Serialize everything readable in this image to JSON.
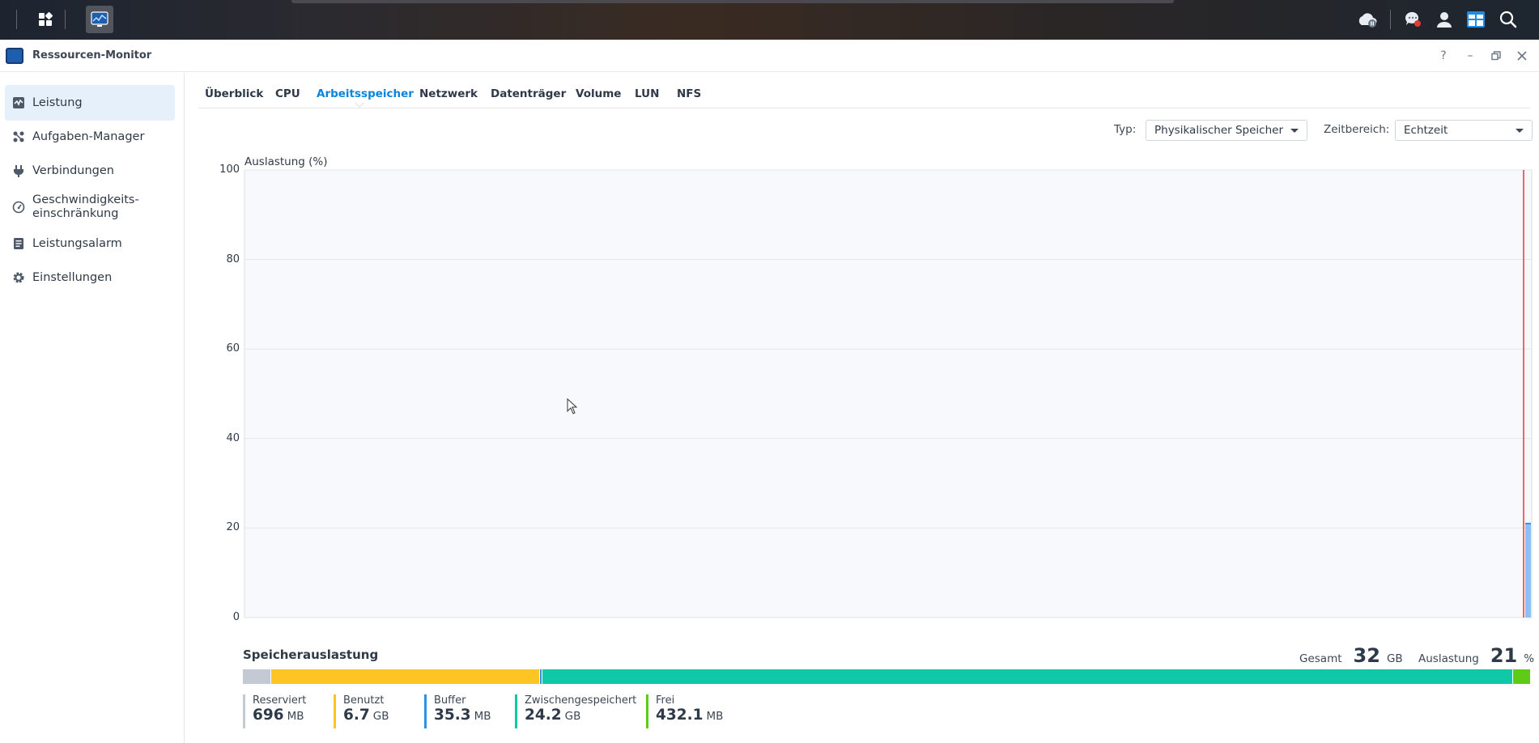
{
  "window": {
    "title": "Ressourcen-Monitor"
  },
  "sidebar": {
    "items": [
      {
        "label": "Leistung",
        "icon": "performance-icon",
        "active": true
      },
      {
        "label": "Aufgaben-Manager",
        "icon": "task-manager-icon"
      },
      {
        "label": "Verbindungen",
        "icon": "plug-icon"
      },
      {
        "label": "Geschwindigkeits-\neinschränkung",
        "icon": "speedometer-icon"
      },
      {
        "label": "Leistungsalarm",
        "icon": "alarm-list-icon"
      },
      {
        "label": "Einstellungen",
        "icon": "gear-icon"
      }
    ]
  },
  "tabs": [
    {
      "label": "Überblick"
    },
    {
      "label": "CPU"
    },
    {
      "label": "Arbeitsspeicher",
      "active": true
    },
    {
      "label": "Netzwerk"
    },
    {
      "label": "Datenträger"
    },
    {
      "label": "Volume"
    },
    {
      "label": "LUN"
    },
    {
      "label": "NFS"
    }
  ],
  "filters": {
    "type_label": "Typ:",
    "type_value": "Physikalischer Speicher",
    "range_label": "Zeitbereich:",
    "range_value": "Echtzeit"
  },
  "chart_data": {
    "type": "area",
    "ylabel": "Auslastung (%)",
    "ylim": [
      0,
      100
    ],
    "yticks": [
      "0",
      "20",
      "40",
      "60",
      "80",
      "100"
    ],
    "grid": true,
    "series": [
      {
        "values": [
          21,
          21
        ]
      }
    ],
    "colors": {
      "fill": "#8fc0f5",
      "line": "#3b8fe6",
      "marker": "#e53935",
      "plot_bg": "#f8f9fc"
    }
  },
  "memory": {
    "title": "Speicherauslastung",
    "total_label": "Gesamt",
    "total_value": "32",
    "total_unit": "GB",
    "usage_label": "Auslastung",
    "usage_value": "21",
    "usage_unit": "%",
    "segments": [
      {
        "name": "Reserviert",
        "value": "696",
        "unit": "MB",
        "fraction": 0.0212,
        "color": "#c3cad3"
      },
      {
        "name": "Benutzt",
        "value": "6.7",
        "unit": "GB",
        "fraction": 0.2094,
        "color": "#fcc524"
      },
      {
        "name": "Buffer",
        "value": "35.3",
        "unit": "MB",
        "fraction": 0.0011,
        "color": "#2f8fe0"
      },
      {
        "name": "Zwischengespeichert",
        "value": "24.2",
        "unit": "GB",
        "fraction": 0.7563,
        "color": "#0ec8a8"
      },
      {
        "name": "Frei",
        "value": "432.1",
        "unit": "MB",
        "fraction": 0.0132,
        "color": "#5ecb16"
      }
    ]
  }
}
